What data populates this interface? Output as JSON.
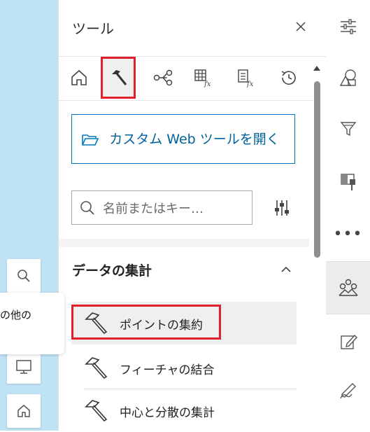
{
  "panel": {
    "title": "ツール"
  },
  "tabs": [
    {
      "name": "home"
    },
    {
      "name": "hammer",
      "active": true
    },
    {
      "name": "flow"
    },
    {
      "name": "table-fx"
    },
    {
      "name": "list-fx"
    },
    {
      "name": "history"
    }
  ],
  "custom_button": {
    "label": "カスタム Web ツールを開く"
  },
  "search": {
    "placeholder": "名前またはキー…"
  },
  "section": {
    "title": "データの集計"
  },
  "tools": [
    {
      "label": "ポイントの集約",
      "selected": true
    },
    {
      "label": "フィーチャの結合"
    },
    {
      "label": "中心と分散の集計"
    }
  ],
  "map": {
    "tooltip_text": "の他の"
  },
  "actionbar": {
    "items": [
      "settings-sliders-icon",
      "shapes-icon",
      "filter-icon",
      "paint-icon",
      "more-icon",
      "analysis-icon",
      "edit-icon",
      "sketch-icon"
    ],
    "more_label": "•••"
  },
  "colors": {
    "accent": "#007ac2",
    "highlight": "#e0202c",
    "map": "#bfe3f4"
  }
}
